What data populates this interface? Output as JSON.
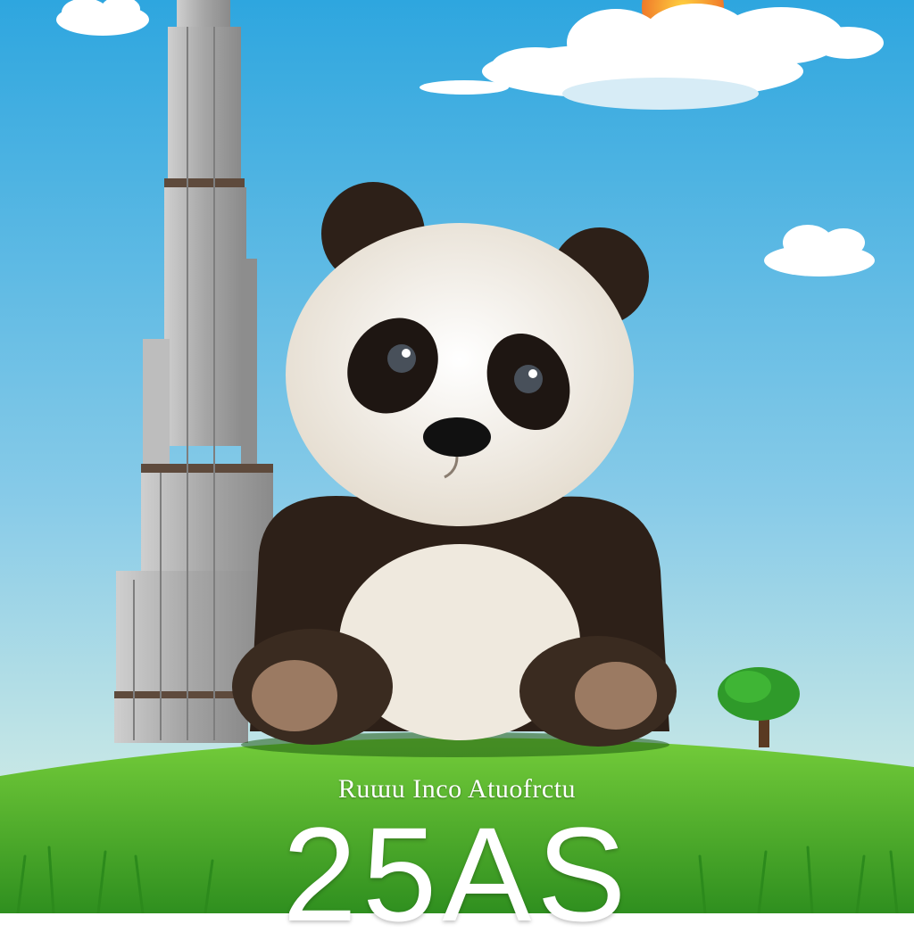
{
  "poster": {
    "subtitle": "Ruɯu Inco Atuofrctu",
    "title": "25AS"
  },
  "colors": {
    "sky_top": "#2fa7e0",
    "sky_bottom": "#e3f4e6",
    "grass": "#52b82d",
    "panda_dark": "#2d2018",
    "panda_light": "#efe9de",
    "tower": "#9a9a9a",
    "sun": "#f4a23a"
  },
  "icons": [
    "sun-icon",
    "cloud-icon",
    "tree-icon"
  ]
}
